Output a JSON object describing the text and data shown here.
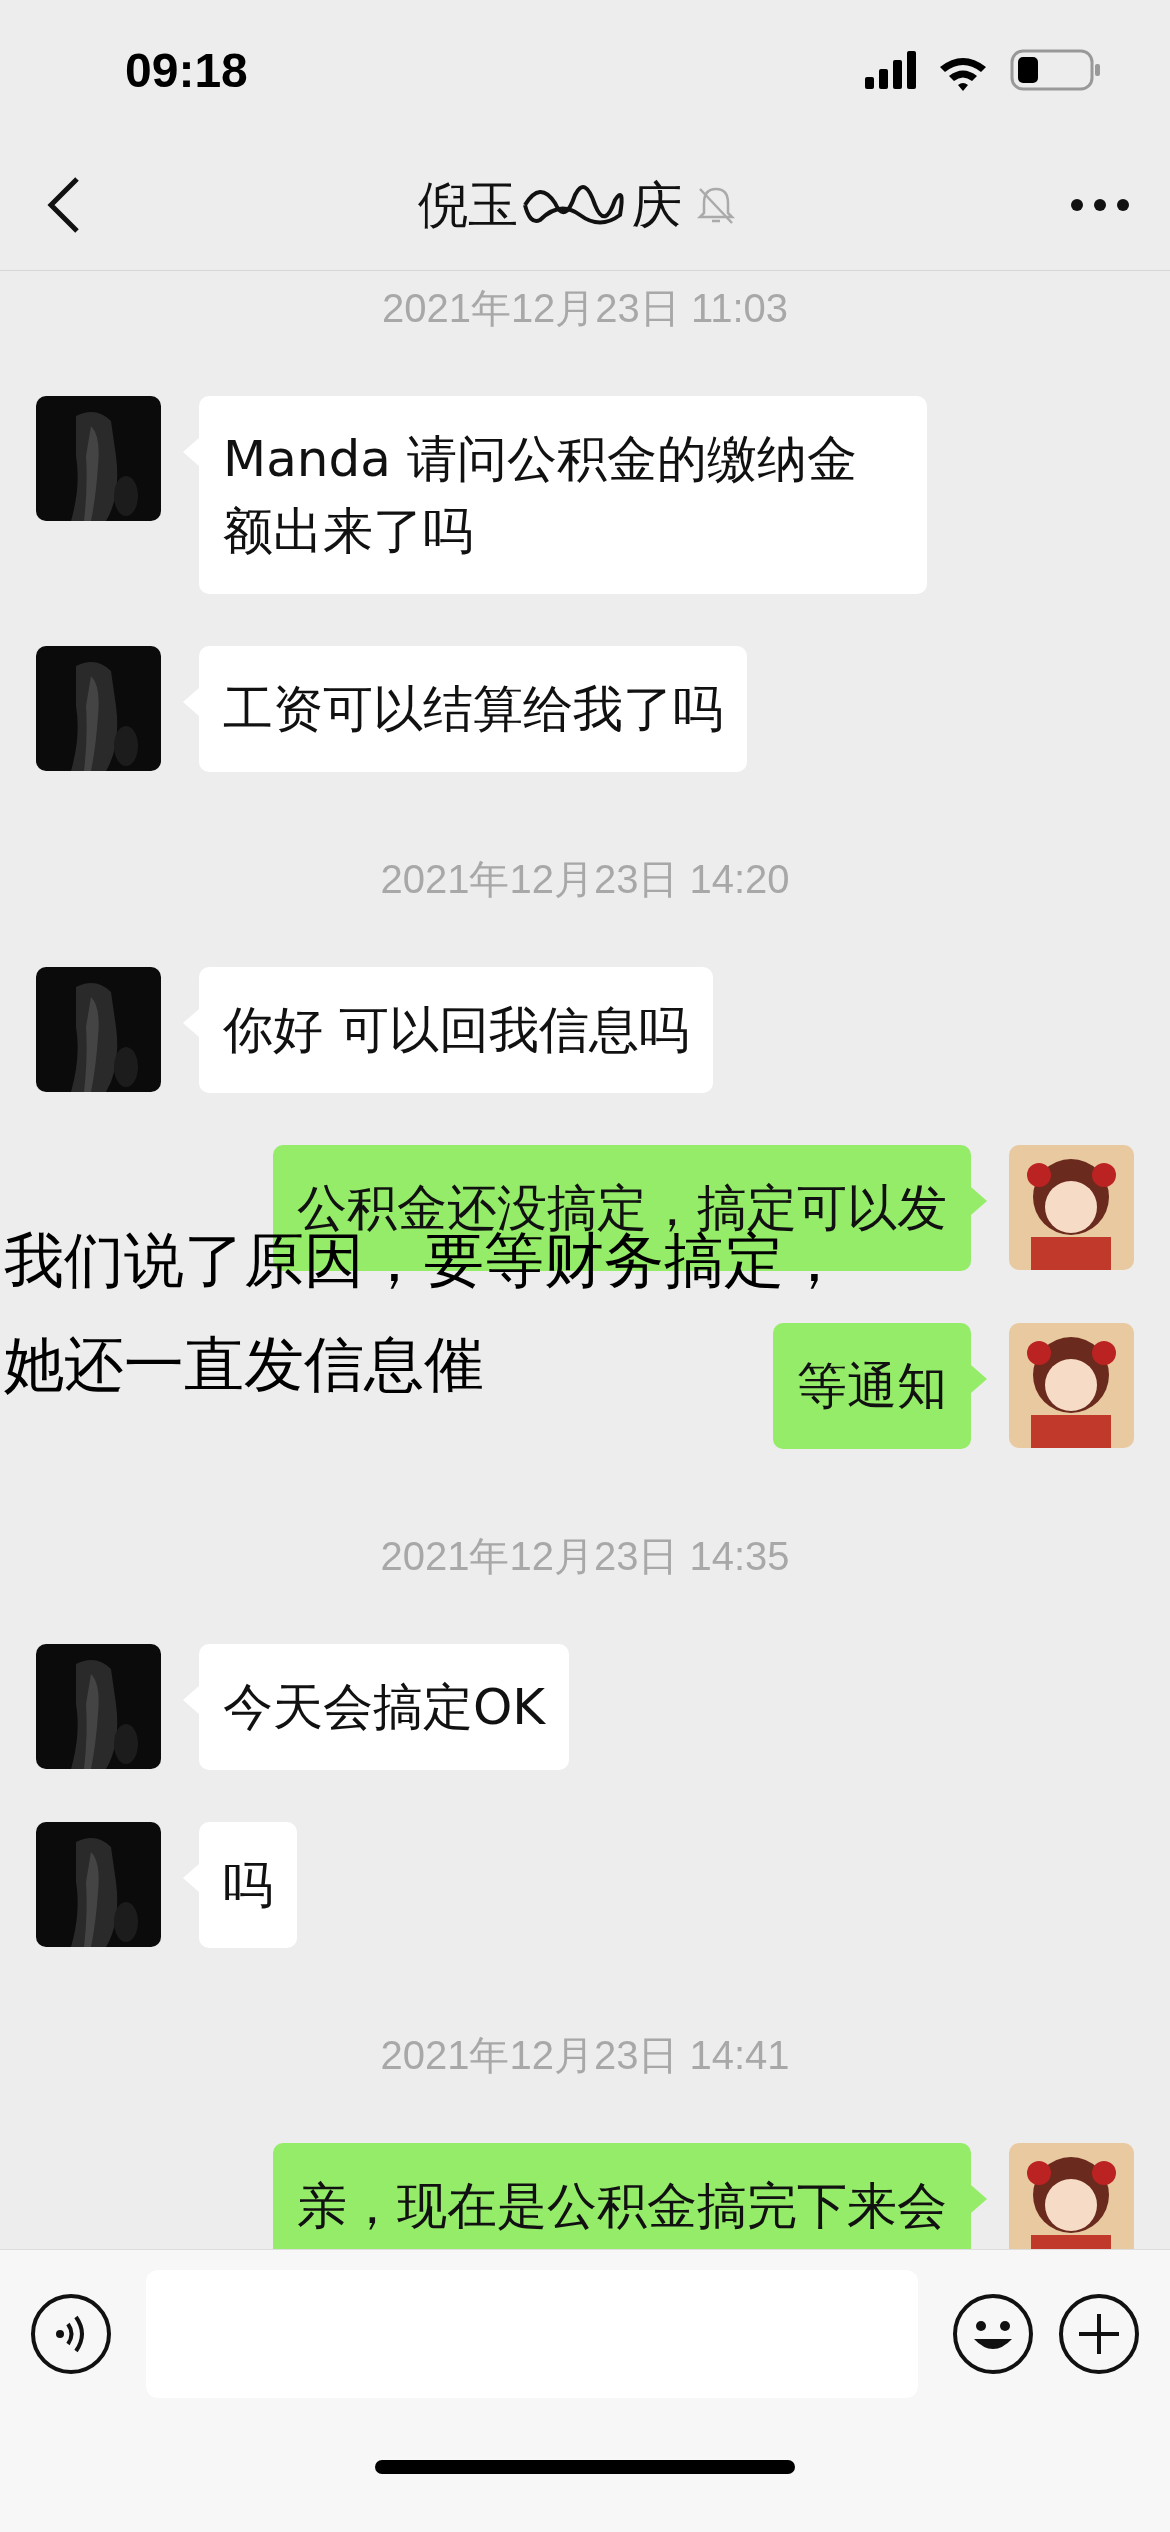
{
  "status_bar": {
    "time": "09:18"
  },
  "header": {
    "title_start": "倪玉",
    "title_end": "庆",
    "muted": true
  },
  "messages": [
    {
      "kind": "time",
      "text": "2021年12月23日 11:03"
    },
    {
      "kind": "received",
      "text": "Manda 请问公积金的缴纳金额出来了吗"
    },
    {
      "kind": "received",
      "text": "工资可以结算给我了吗"
    },
    {
      "kind": "time",
      "text": "2021年12月23日 14:20"
    },
    {
      "kind": "received",
      "text": "你好 可以回我信息吗"
    },
    {
      "kind": "sent",
      "text": "公积金还没搞定，搞定可以发"
    },
    {
      "kind": "sent",
      "text": "等通知"
    },
    {
      "kind": "time",
      "text": "2021年12月23日 14:35"
    },
    {
      "kind": "received",
      "text": "今天会搞定OK"
    },
    {
      "kind": "received",
      "text": "吗"
    },
    {
      "kind": "time",
      "text": "2021年12月23日 14:41"
    },
    {
      "kind": "sent",
      "text": "亲，现在是公积金搞完下来会"
    }
  ],
  "caption_lines": [
    "我们说了原因，要等财务搞定，",
    "她还一直发信息催"
  ]
}
